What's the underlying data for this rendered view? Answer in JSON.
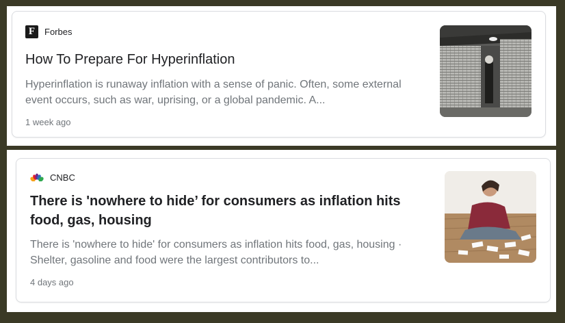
{
  "articles": [
    {
      "source": "Forbes",
      "title": "How To Prepare For Hyperinflation",
      "snippet_line1": "Hyperinflation is runaway inflation with a sense of panic. Often, some external",
      "snippet_line2": "event occurs, such as war, uprising, or a global pandemic. A...",
      "age": "1 week ago",
      "logo_letter": "F"
    },
    {
      "source": "CNBC",
      "title_line1": "There is 'nowhere to hide’ for consumers as inflation hits",
      "title_line2": "food, gas, housing",
      "snippet_line1": "There is 'nowhere to hide' for consumers as inflation hits food, gas, housing ·",
      "snippet_line2": "Shelter, gasoline and food were the largest contributors to...",
      "age": "4 days ago"
    }
  ],
  "colors": {
    "background": "#3b3a26",
    "card_border": "#dadce0",
    "title": "#202124",
    "snippet": "#70757a"
  }
}
